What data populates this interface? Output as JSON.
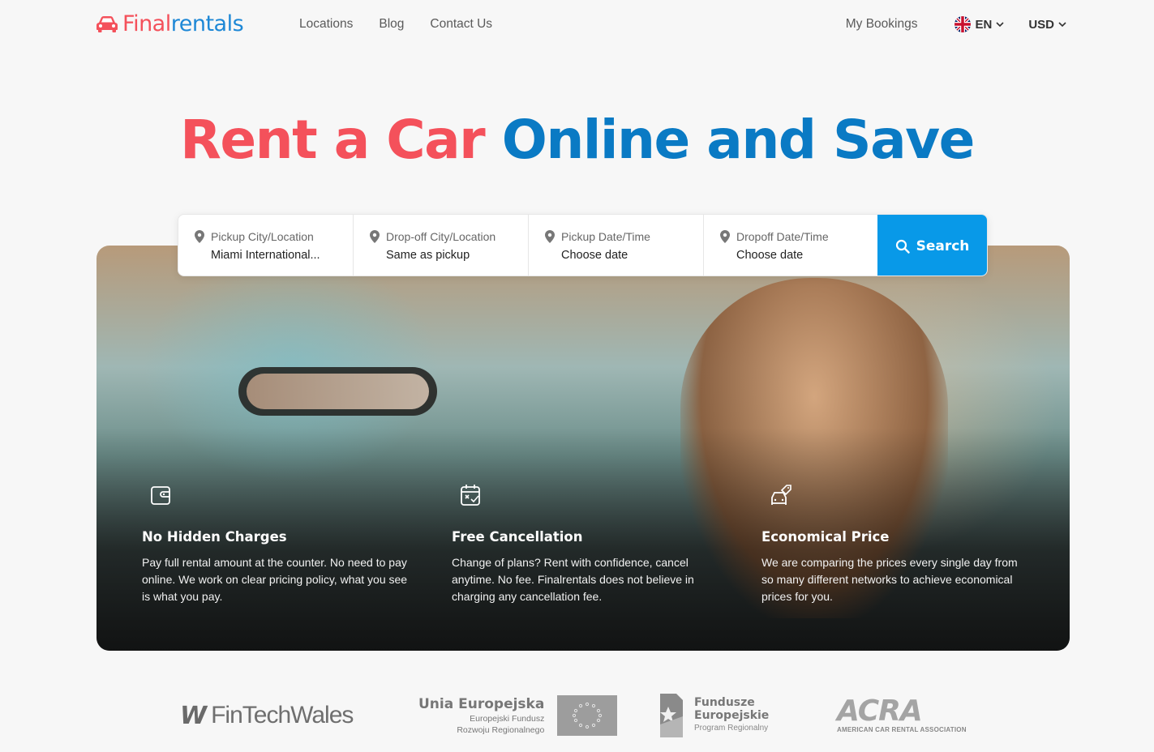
{
  "header": {
    "logo": {
      "part1": "Final",
      "part2": "rentals"
    },
    "nav": [
      "Locations",
      "Blog",
      "Contact Us"
    ],
    "my_bookings": "My Bookings",
    "language": "EN",
    "currency": "USD"
  },
  "hero": {
    "title_part1": "Rent a Car",
    "title_part2": "Online and Save"
  },
  "search": {
    "pickup_location": {
      "label": "Pickup City/Location",
      "value": "Miami International..."
    },
    "dropoff_location": {
      "label": "Drop-off City/Location",
      "value": "Same as pickup"
    },
    "pickup_date": {
      "label": "Pickup Date/Time",
      "value": "Choose date"
    },
    "dropoff_date": {
      "label": "Dropoff Date/Time",
      "value": "Choose date"
    },
    "button": "Search"
  },
  "features": [
    {
      "icon": "wallet-icon",
      "title": "No Hidden Charges",
      "text": "Pay full rental amount at the counter. No need to pay online. We work on clear pricing policy, what you see is what you pay."
    },
    {
      "icon": "calendar-cancel-icon",
      "title": "Free Cancellation",
      "text": "Change of plans? Rent with confidence, cancel anytime. No fee. Finalrentals does not believe in charging any cancellation fee."
    },
    {
      "icon": "car-tag-icon",
      "title": "Economical Price",
      "text": "We are comparing the prices every single day from so many different networks to achieve economical prices for you."
    }
  ],
  "partners": {
    "fintech": "FinTechWales",
    "ue": {
      "title": "Unia Europejska",
      "line1": "Europejski Fundusz",
      "line2": "Rozwoju Regionalnego"
    },
    "fe": {
      "line1": "Fundusze",
      "line2": "Europejskie",
      "line3": "Program Regionalny"
    },
    "acra": {
      "name": "ACRA",
      "full": "AMERICAN CAR RENTAL ASSOCIATION"
    }
  },
  "colors": {
    "brand_red": "#f4515b",
    "brand_blue": "#0a7ac4",
    "search_button": "#0899e8"
  }
}
